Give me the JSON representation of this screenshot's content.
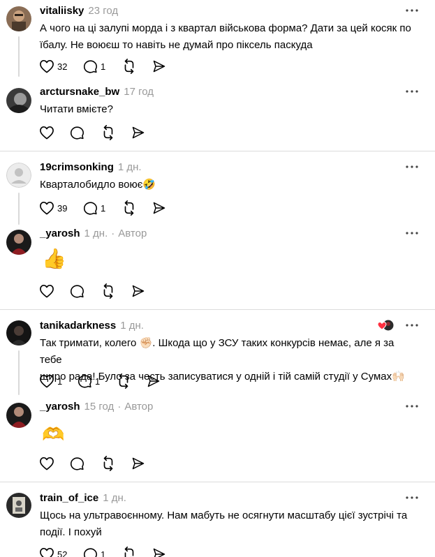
{
  "threads": [
    {
      "root": {
        "username": "vitaliisky",
        "time": "23 год",
        "text": "А чого на ці залупі морда і з квартал військова форма? Дати за цей косяк по їбалу. Не воюєш то навіть не думай про піксель паскуда",
        "likes": "32",
        "replies": "1"
      },
      "reply": {
        "username": "arctursnake_bw",
        "time": "17 год",
        "text": "Читати вмієте?"
      }
    },
    {
      "root": {
        "username": "19crimsonking",
        "time": "1 дн.",
        "text": "Кварталобидло воює",
        "emoji": "🤣",
        "likes": "39",
        "replies": "1"
      },
      "reply": {
        "username": "_yarosh",
        "time": "1 дн.",
        "author_label": "Автор",
        "emoji": "👍"
      }
    },
    {
      "root": {
        "username": "tanikadarkness",
        "time": "1 дн.",
        "text_line1": "Так тримати, колего",
        "text_line1_rest": ". Шкода що у ЗСУ таких конкурсів немає, але я за тебе",
        "text_line2": "щиро рада! Було за честь записуватися у одній і тій самій студії у Сумах",
        "emoji_fist": "✊🏻",
        "emoji_hands": "🙌🏻",
        "likes": "1",
        "replies": "1"
      },
      "reply": {
        "username": "_yarosh",
        "time": "15 год",
        "author_label": "Автор",
        "emoji": "🫶"
      }
    },
    {
      "root": {
        "username": "train_of_ice",
        "time": "1 дн.",
        "text": "Щось на ультравоєнному. Нам мабуть не осягнути масштабу цієї зустрічі та події. І похуй",
        "likes": "52",
        "replies": "1"
      }
    }
  ],
  "icons": {
    "like": "heart-icon",
    "reply": "comment-icon",
    "repost": "repost-icon",
    "share": "send-icon",
    "more": "more-dots-icon"
  },
  "colors": {
    "muted": "#999999",
    "divider": "#dcdcdc",
    "heart_red": "#ff3040"
  }
}
